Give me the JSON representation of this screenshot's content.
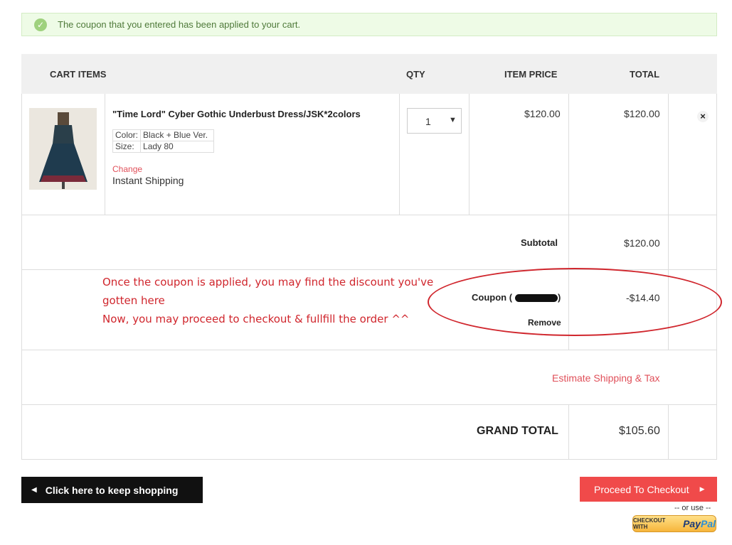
{
  "message": {
    "icon": "check-circle-icon",
    "text": "The coupon that you entered has been applied to your cart."
  },
  "header": {
    "cart_items": "CART ITEMS",
    "qty": "QTY",
    "item_price": "ITEM PRICE",
    "total": "TOTAL"
  },
  "item": {
    "name": "\"Time Lord\" Cyber Gothic Underbust Dress/JSK*2colors",
    "attributes": [
      {
        "label": "Color:",
        "value": "Black + Blue Ver."
      },
      {
        "label": "Size:",
        "value": "Lady 80"
      }
    ],
    "change_label": "Change",
    "shipping": "Instant Shipping",
    "qty": "1",
    "price": "$120.00",
    "total": "$120.00",
    "remove_glyph": "×"
  },
  "summary": {
    "subtotal_label": "Subtotal",
    "subtotal_value": "$120.00",
    "coupon_label": "Coupon (",
    "coupon_label_end": ")",
    "coupon_value": "-$14.40",
    "coupon_remove": "Remove",
    "estimate_link": "Estimate Shipping & Tax",
    "grand_total_label": "GRAND TOTAL",
    "grand_total_value": "$105.60"
  },
  "annotation": {
    "line1": "Once the coupon is applied, you may find the discount you've",
    "line2": "gotten here",
    "line3": "Now, you may proceed to checkout & fullfill the order ^^"
  },
  "buttons": {
    "keep_shopping": "Click here to keep shopping",
    "proceed": "Proceed To Checkout",
    "or_use": "-- or use --",
    "paypal_small": "CHECKOUT WITH",
    "paypal_pay": "Pay",
    "paypal_pal": "Pal"
  },
  "colors": {
    "accent_red": "#f04a4a",
    "success_bg": "#eefbe6",
    "link_red": "#e0505a",
    "annotation_red": "#d0262d"
  }
}
